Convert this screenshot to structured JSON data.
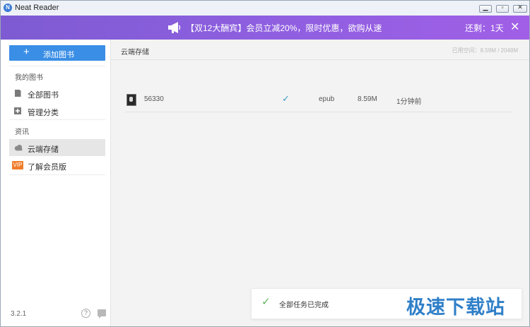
{
  "window": {
    "title": "Neat Reader",
    "logo_letter": "N"
  },
  "banner": {
    "text": "【双12大酬宾】会员立减20%，限时优惠，欲购从速",
    "remaining": "还剩：1天",
    "close_glyph": "✕",
    "bg_gradient": [
      "#7e5bd2",
      "#a05fe6"
    ]
  },
  "sidebar": {
    "add_book": {
      "plus": "+",
      "label": "添加图书"
    },
    "section_books": "我的图书",
    "items_books": [
      {
        "label": "全部图书",
        "icon": "book-icon"
      },
      {
        "label": "管理分类",
        "icon": "plus-square-icon"
      }
    ],
    "section_info": "资讯",
    "items_info": [
      {
        "label": "云端存储",
        "icon": "cloud-icon",
        "active": true
      },
      {
        "label": "了解会员版",
        "icon": "vip-badge-icon",
        "badge": "VIP"
      }
    ],
    "version": "3.2.1",
    "help_glyph": "?"
  },
  "main": {
    "title": "云端存储",
    "storage": "已用空间：8.59M / 2048M",
    "files": [
      {
        "name": "56330",
        "status": "✓",
        "format": "epub",
        "size": "8.59M",
        "time": "1分钟前"
      }
    ]
  },
  "toast": {
    "glyph": "✓",
    "text": "全部任务已完成"
  },
  "watermark": {
    "text": "极速下载站"
  },
  "colors": {
    "accent_blue": "#3a8ee6",
    "check_teal": "#3d9fc4",
    "toast_green": "#5cb85c",
    "vip_orange": "#f07d2b"
  }
}
